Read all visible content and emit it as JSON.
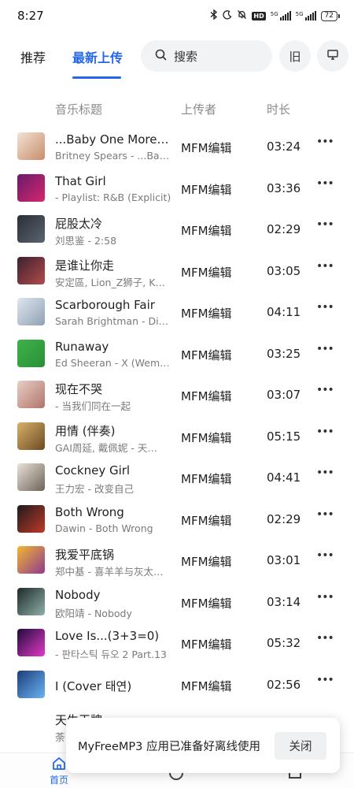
{
  "status_bar": {
    "time": "8:27",
    "signal_tag": "5G",
    "hd_label": "HD",
    "battery": "72"
  },
  "top_nav": {
    "tabs": [
      {
        "label": "推荐",
        "active": false
      },
      {
        "label": "最新上传",
        "active": true
      }
    ],
    "search_placeholder": "搜索",
    "old_version_label": "旧",
    "accent_color": "#2167e8"
  },
  "columns": {
    "title": "音乐标题",
    "uploader": "上传者",
    "duration": "时长"
  },
  "songs": [
    {
      "title": "...Baby One More Time",
      "subtitle": "Britney Spears - ...Baby One More Time",
      "uploader": "MFM编辑",
      "duration": "03:24"
    },
    {
      "title": "That Girl",
      "subtitle": "- Playlist: R&B (Explicit)",
      "uploader": "MFM编辑",
      "duration": "03:36"
    },
    {
      "title": "屁股太冷",
      "subtitle": "刘思鉴 - 2:58",
      "uploader": "MFM编辑",
      "duration": "02:29"
    },
    {
      "title": "是谁让你走",
      "subtitle": "安定區, Lion_Z狮子, K…",
      "uploader": "MFM编辑",
      "duration": "03:05"
    },
    {
      "title": "Scarborough Fair",
      "subtitle": "Sarah Brightman - Di…",
      "uploader": "MFM编辑",
      "duration": "04:11"
    },
    {
      "title": "Runaway",
      "subtitle": "Ed Sheeran - X (Wem…",
      "uploader": "MFM编辑",
      "duration": "03:25"
    },
    {
      "title": "现在不哭",
      "subtitle": "- 当我们同在一起",
      "uploader": "MFM编辑",
      "duration": "03:07"
    },
    {
      "title": "用情 (伴奏)",
      "subtitle": "GAI周延, 戴佩妮 - 天…",
      "uploader": "MFM编辑",
      "duration": "05:15"
    },
    {
      "title": "Cockney Girl",
      "subtitle": "王力宏 - 改变自己",
      "uploader": "MFM编辑",
      "duration": "04:41"
    },
    {
      "title": "Both Wrong",
      "subtitle": "Dawin - Both Wrong",
      "uploader": "MFM编辑",
      "duration": "02:29"
    },
    {
      "title": "我爱平底锅",
      "subtitle": "郑中基 - 喜羊羊与灰太…",
      "uploader": "MFM编辑",
      "duration": "03:01"
    },
    {
      "title": "Nobody",
      "subtitle": "欧阳靖 - Nobody",
      "uploader": "MFM编辑",
      "duration": "03:14"
    },
    {
      "title": "Love Is...(3+3=0)",
      "subtitle": "- 판타스틱 듀오 2 Part.13",
      "uploader": "MFM编辑",
      "duration": "05:32"
    },
    {
      "title": "I (Cover 태연)",
      "subtitle": "",
      "uploader": "MFM编辑",
      "duration": "02:56"
    },
    {
      "title": "天生王牌",
      "subtitle": "荼",
      "uploader": "",
      "duration": ""
    }
  ],
  "covers": [
    {
      "from": "#f3e2d6",
      "to": "#c98d6a"
    },
    {
      "from": "#6a1b6e",
      "to": "#d6266b"
    },
    {
      "from": "#2a2f36",
      "to": "#5b6470"
    },
    {
      "from": "#3a2230",
      "to": "#b44a4a"
    },
    {
      "from": "#dfe6ee",
      "to": "#8fa1b5"
    },
    {
      "from": "#3eb34a",
      "to": "#2a8f37"
    },
    {
      "from": "#e8cfc6",
      "to": "#b27468"
    },
    {
      "from": "#d9b16a",
      "to": "#6b4a22"
    },
    {
      "from": "#e9e2d8",
      "to": "#6d6358"
    },
    {
      "from": "#1e1a1a",
      "to": "#c0392b"
    },
    {
      "from": "#f2b632",
      "to": "#8e3a8e"
    },
    {
      "from": "#1d2a2a",
      "to": "#8fb0a8"
    },
    {
      "from": "#1f0a3a",
      "to": "#e23ac9"
    },
    {
      "from": "#1c3e7a",
      "to": "#6cb3f2"
    },
    {
      "from": "#ffffff",
      "to": "#ffffff"
    }
  ],
  "bottom_nav": {
    "home_label": "首页"
  },
  "toast": {
    "message": "MyFreeMP3 应用已准备好离线使用",
    "close_label": "关闭"
  }
}
